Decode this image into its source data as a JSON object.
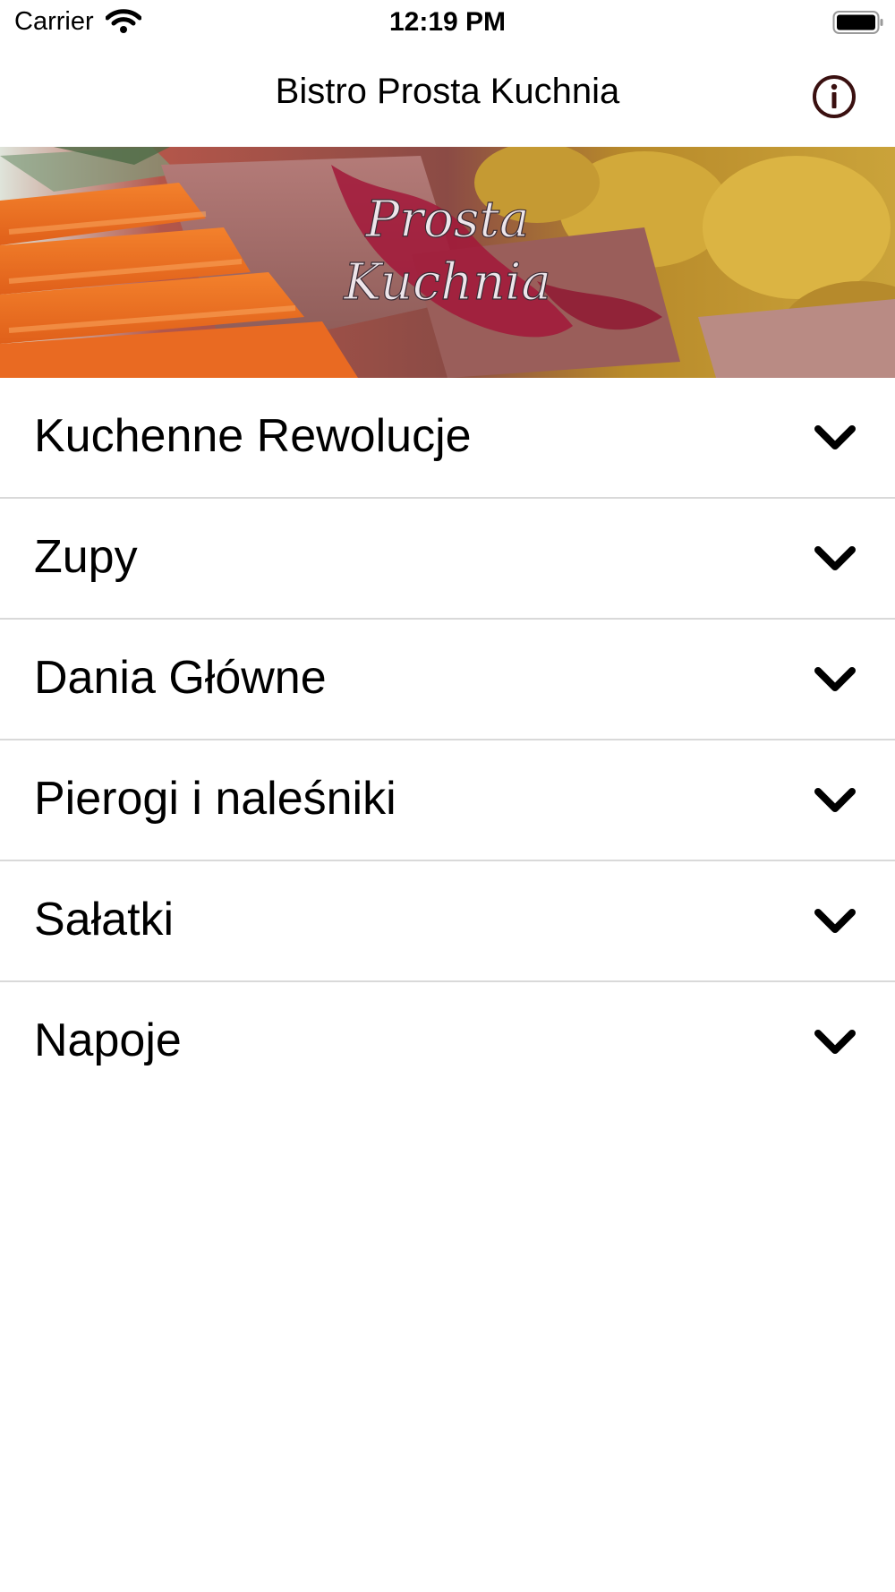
{
  "status_bar": {
    "carrier": "Carrier",
    "time": "12:19 PM"
  },
  "nav": {
    "title": "Bistro Prosta Kuchnia",
    "info_icon": "info-circle-icon"
  },
  "hero": {
    "logo_line1": "Prosta",
    "logo_line2": "Kuchnia"
  },
  "menu": {
    "items": [
      {
        "label": "Kuchenne Rewolucje"
      },
      {
        "label": "Zupy"
      },
      {
        "label": "Dania Główne"
      },
      {
        "label": "Pierogi i naleśniki"
      },
      {
        "label": "Sałatki"
      },
      {
        "label": "Napoje"
      }
    ],
    "expand_icon": "chevron-down-icon"
  },
  "colors": {
    "info_icon": "#3a1010",
    "separator": "#d9d9d9"
  }
}
